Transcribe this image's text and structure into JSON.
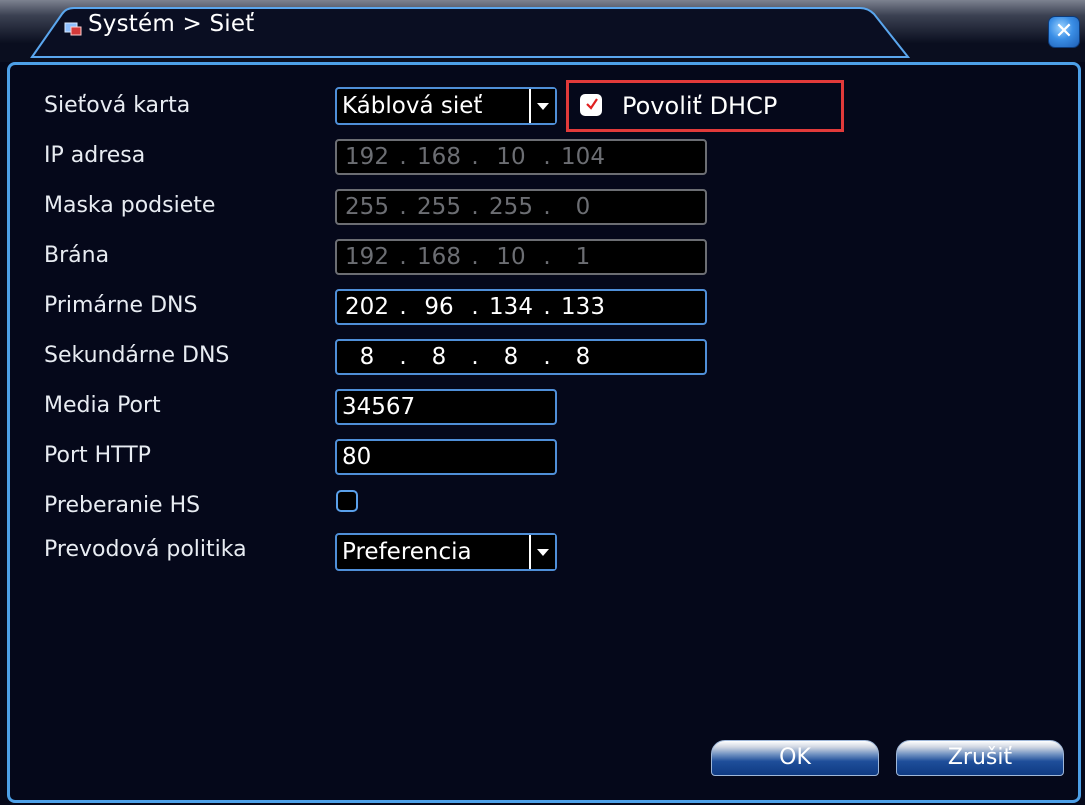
{
  "window": {
    "title": "Systém > Sieť",
    "close_icon": "close-icon"
  },
  "form": {
    "network_card": {
      "label": "Sieťová karta",
      "value": "Káblová sieť"
    },
    "dhcp": {
      "label": "Povoliť DHCP",
      "checked": true
    },
    "ip_address": {
      "label": "IP adresa",
      "octets": [
        "192",
        "168",
        "10",
        "104"
      ],
      "enabled": false
    },
    "subnet_mask": {
      "label": "Maska podsiete",
      "octets": [
        "255",
        "255",
        "255",
        "0"
      ],
      "enabled": false
    },
    "gateway": {
      "label": "Brána",
      "octets": [
        "192",
        "168",
        "10",
        "1"
      ],
      "enabled": false
    },
    "primary_dns": {
      "label": "Primárne DNS",
      "octets": [
        "202",
        "96",
        "134",
        "133"
      ],
      "enabled": true
    },
    "secondary_dns": {
      "label": "Sekundárne DNS",
      "octets": [
        "8",
        "8",
        "8",
        "8"
      ],
      "enabled": true
    },
    "media_port": {
      "label": "Media Port",
      "value": "34567"
    },
    "http_port": {
      "label": "Port HTTP",
      "value": "80"
    },
    "hs_download": {
      "label": "Preberanie HS",
      "checked": false
    },
    "transfer_policy": {
      "label": "Prevodová politika",
      "value": "Preferencia"
    }
  },
  "buttons": {
    "ok": "OK",
    "cancel": "Zrušiť"
  },
  "colors": {
    "background": "#05081a",
    "border_accent": "#4da0e8",
    "highlight": "#e23a3a",
    "disabled_text": "#6c6e73"
  }
}
